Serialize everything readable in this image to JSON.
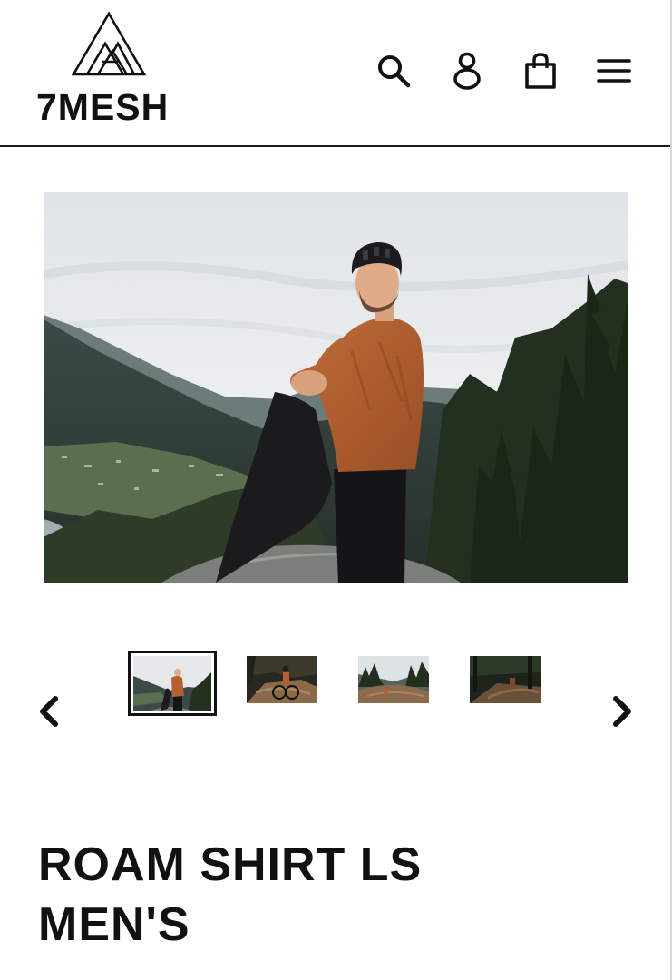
{
  "brand": {
    "name": "7MESH"
  },
  "header": {
    "icons": [
      "search-icon",
      "account-icon",
      "cart-icon",
      "menu-icon"
    ]
  },
  "gallery": {
    "thumbnails": [
      "thumbnail-1",
      "thumbnail-2",
      "thumbnail-3",
      "thumbnail-4"
    ],
    "active_index": 0
  },
  "product": {
    "title_line1": "ROAM SHIRT LS",
    "title_line2": "MEN'S"
  },
  "colors": {
    "text": "#111111",
    "shirt": "#b4612f",
    "sky": "#e7ebee",
    "forest": "#24301f"
  }
}
